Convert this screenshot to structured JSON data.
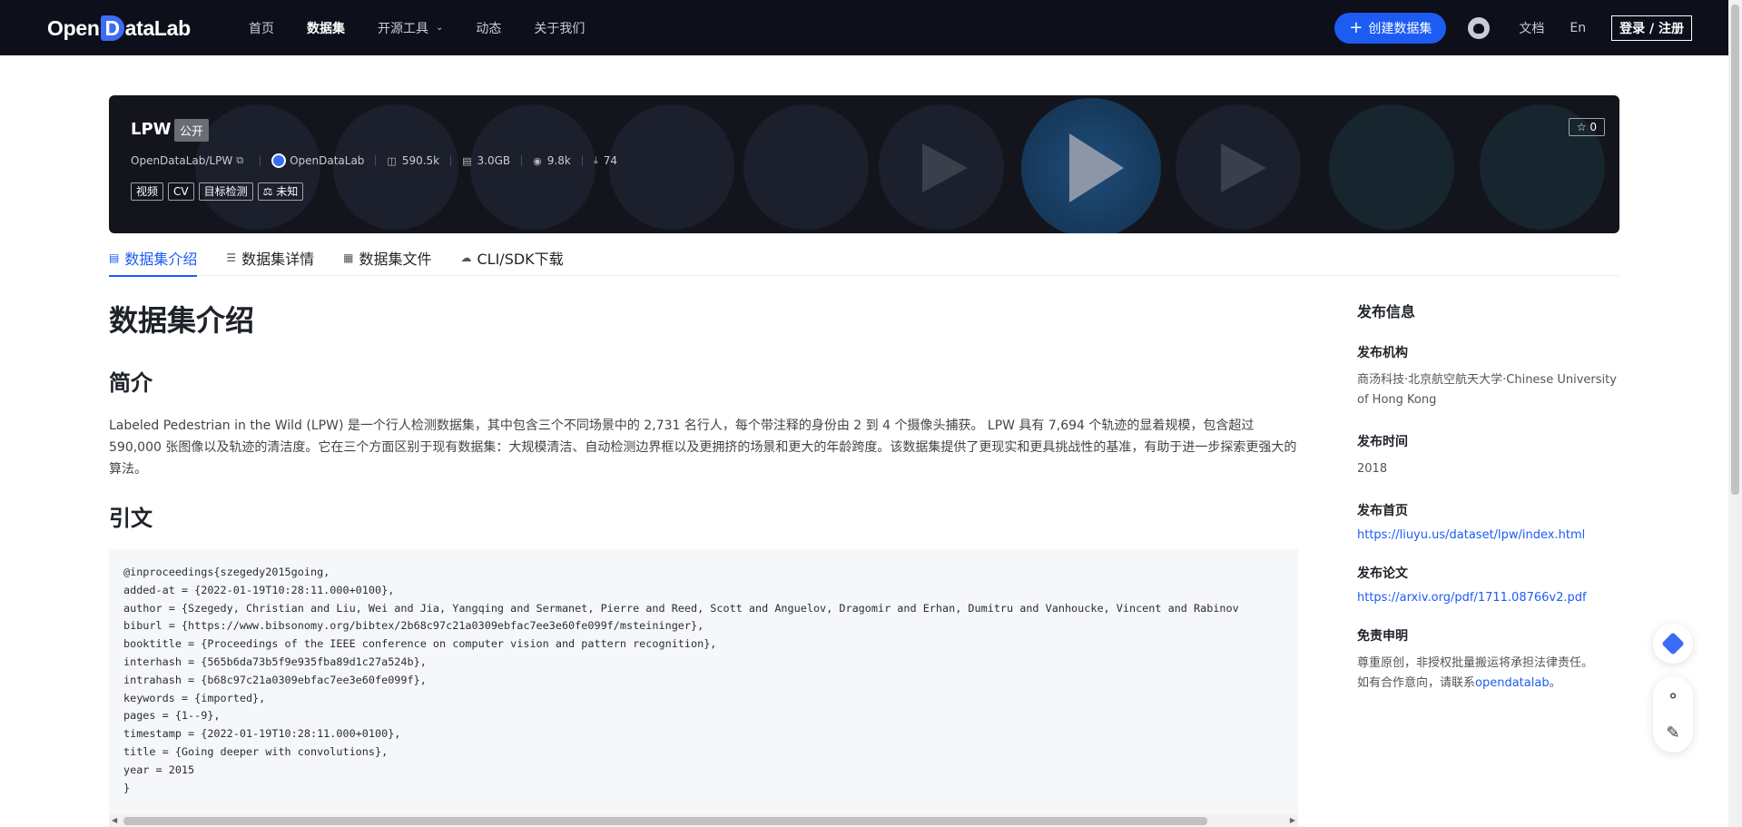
{
  "nav": {
    "logo_prefix": "Open",
    "logo_mark": "D",
    "logo_suffix": "ataLab",
    "links": [
      "首页",
      "数据集",
      "开源工具",
      "动态",
      "关于我们"
    ],
    "create_label": "创建数据集",
    "docs_label": "文档",
    "lang_label": "En",
    "login_label": "登录 / 注册"
  },
  "banner": {
    "title": "LPW",
    "visibility": "公开",
    "path": "OpenDataLab/LPW",
    "org": "OpenDataLab",
    "file_count": "590.5k",
    "size": "3.0GB",
    "views": "9.8k",
    "downloads": "74",
    "tags": [
      "视频",
      "CV",
      "目标检测",
      "未知"
    ],
    "stars": "0"
  },
  "tabs": [
    "数据集介绍",
    "数据集详情",
    "数据集文件",
    "CLI/SDK下载"
  ],
  "content": {
    "heading": "数据集介绍",
    "intro_heading": "简介",
    "intro_text": "Labeled Pedestrian in the Wild (LPW) 是一个行人检测数据集，其中包含三个不同场景中的 2,731 名行人，每个带注释的身份由 2 到 4 个摄像头捕获。 LPW 具有 7,694 个轨迹的显着规模，包含超过 590,000 张图像以及轨迹的清洁度。它在三个方面区别于现有数据集：大规模清洁、自动检测边界框以及更拥挤的场景和更大的年龄跨度。该数据集提供了更现实和更具挑战性的基准，有助于进一步探索更强大的算法。",
    "citation_heading": "引文",
    "citation_lines": [
      "@inproceedings{szegedy2015going,",
      "added-at = {2022-01-19T10:28:11.000+0100},",
      "author = {Szegedy, Christian and Liu, Wei and Jia, Yangqing and Sermanet, Pierre and Reed, Scott and Anguelov, Dragomir and Erhan, Dumitru and Vanhoucke, Vincent and Rabinov",
      "biburl = {https://www.bibsonomy.org/bibtex/2b68c97c21a0309ebfac7ee3e60fe099f/msteininger},",
      "booktitle = {Proceedings of the IEEE conference on computer vision and pattern recognition},",
      "interhash = {565b6da73b5f9e935fba89d1c27a524b},",
      "intrahash = {b68c97c21a0309ebfac7ee3e60fe099f},",
      "keywords = {imported},",
      "pages = {1--9},",
      "timestamp = {2022-01-19T10:28:11.000+0100},",
      "title = {Going deeper with convolutions},",
      "year = 2015",
      "}"
    ]
  },
  "sidebar": {
    "title": "发布信息",
    "org_label": "发布机构",
    "org_value": "商汤科技·北京航空航天大学·Chinese University of Hong Kong",
    "time_label": "发布时间",
    "time_value": "2018",
    "home_label": "发布首页",
    "home_url": "https://liuyu.us/dataset/lpw/index.html",
    "paper_label": "发布论文",
    "paper_url": "https://arxiv.org/pdf/1711.08766v2.pdf",
    "disclaimer_label": "免责申明",
    "disclaimer_line1": "尊重原创，非授权批量搬运将承担法律责任。",
    "disclaimer_line2_prefix": "如有合作意向，请联系",
    "disclaimer_link": "opendatalab",
    "disclaimer_line2_suffix": "。"
  },
  "colors": {
    "accent": "#1c5cf2",
    "nav_bg": "#0d0f1a",
    "banner_bg": "#14151c"
  }
}
